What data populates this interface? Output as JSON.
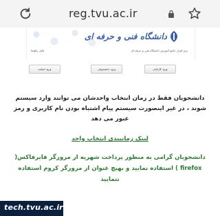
{
  "browser": {
    "url": "reg.tvu.ac.ir",
    "reload_icon": "reload-icon",
    "lock_icon": "lock-icon",
    "star_icon": "star-icon"
  },
  "header": {
    "logo_text": "دانشگاه فنی و حرفه ای",
    "subtitle": "نرم افزار جامع آموزش دانشگاه فنی و حرفه ای",
    "help_link": "فایل راهنما"
  },
  "buttons": [
    {
      "label": "ورود کارکنان"
    },
    {
      "label": "ورود دانشجویان"
    },
    {
      "label": "ورود اساتید"
    }
  ],
  "content": {
    "notice": "دانشجویان فقط در زمان انتخاب واحدشان می توانند وارد سیستم شوند ، در غیر اینصورت سیستم پیام اشتباه بودن نام کاربری و رمز عبور می دهد",
    "timing_link": "لینک زمانبندی انتخاب واحد",
    "browser_notice": "دانشجویان گرامی به منظور پرداخت شهریه از مرورگر فایرفاکس( firefox ) استفاده نمایید و بهیچ عنوان از مرورگر کروم استفاده ننمایید"
  },
  "watermark": {
    "text": "tech.tvu.ac.ir"
  },
  "colors": {
    "accent_green": "#2e7d32",
    "logo_blue": "#3a5fa8",
    "watermark_bg": "#0b1f3f"
  }
}
